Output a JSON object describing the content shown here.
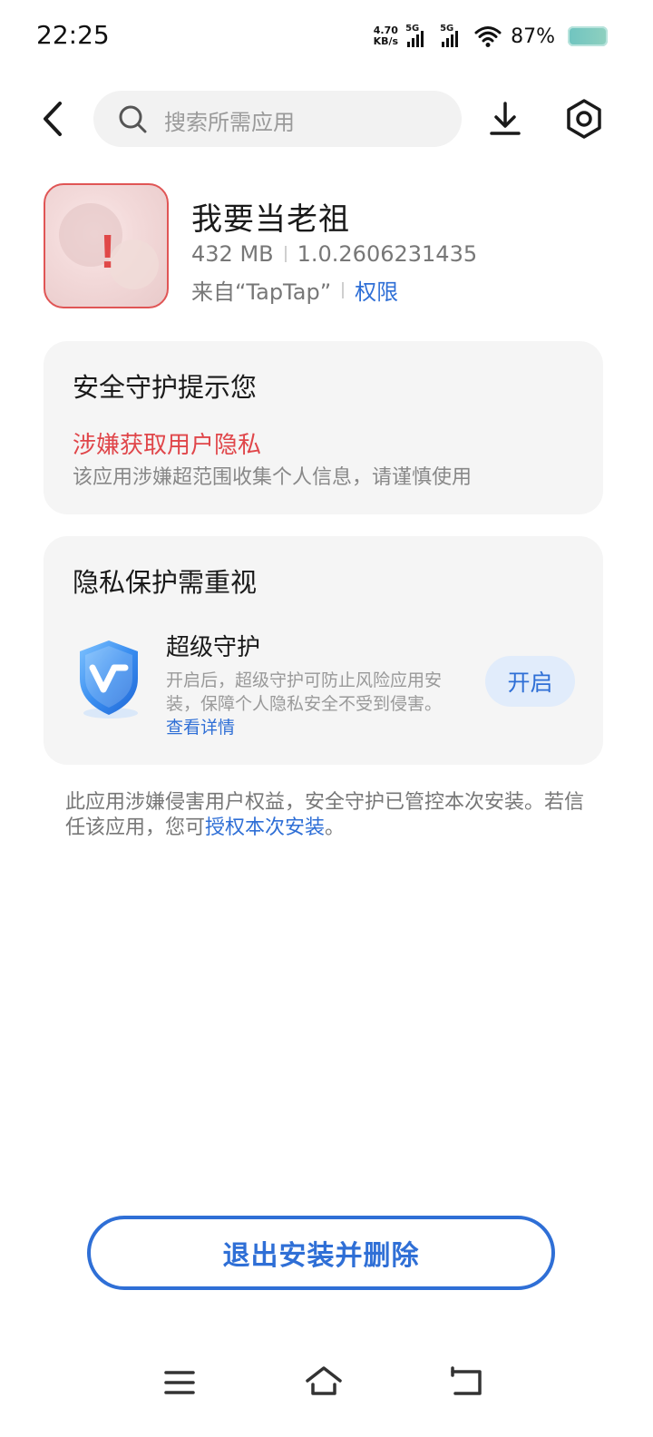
{
  "status_bar": {
    "time": "22:25",
    "net_speed_value": "4.70",
    "net_speed_unit": "KB/s",
    "sim1_type": "5G",
    "sim2_type": "5G",
    "battery_percent": "87%"
  },
  "top_bar": {
    "search_placeholder": "搜索所需应用"
  },
  "app": {
    "name": "我要当老祖",
    "size": "432 MB",
    "version": "1.0.2606231435",
    "source": "来自“TapTap”",
    "permissions_link": "权限",
    "icon_alert_glyph": "!"
  },
  "security_card": {
    "title": "安全守护提示您",
    "warning_title": "涉嫌获取用户隐私",
    "warning_desc": "该应用涉嫌超范围收集个人信息，请谨慎使用"
  },
  "privacy_card": {
    "title": "隐私保护需重视",
    "feature_title": "超级守护",
    "feature_desc": "开启后，超级守护可防止风险应用安装，保障个人隐私安全不受到侵害。",
    "details_link": "查看详情",
    "enable_button": "开启"
  },
  "note": {
    "text_part1": "此应用涉嫌侵害用户权益，安全守护已管控本次安装。若信任该应用，您可",
    "authorize_link": "授权本次安装",
    "text_part2": "。"
  },
  "exit_button": "退出安装并删除",
  "colors": {
    "accent": "#2f6fd6",
    "warning": "#e0464a",
    "card_bg": "#f5f5f5"
  }
}
